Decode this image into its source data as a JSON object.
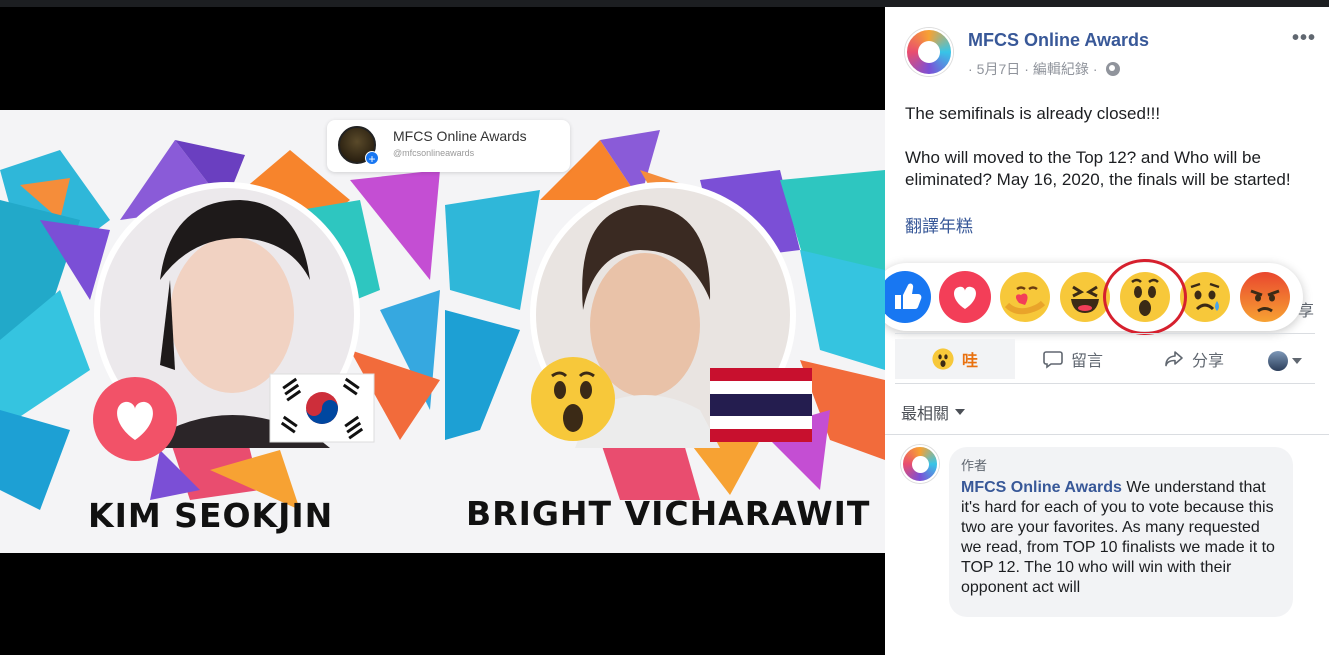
{
  "photo": {
    "tag_name": "MFCS Online Awards",
    "tag_handle": "@mfcsonlineawards",
    "left_name": "KIM SEOKJIN",
    "right_name": "BRIGHT VICHARAWIT"
  },
  "post": {
    "page_name": "MFCS Online Awards",
    "date": "5月7日",
    "edit_history": "編輯紀錄",
    "text_line1": "The semifinals is already closed!!!",
    "text_line2": "Who will moved to the Top 12? and Who will be eliminated? May 16, 2020, the finals will be started!",
    "translate_label": "翻譯年糕",
    "share_fragment": "享"
  },
  "reactions": [
    "like-icon",
    "love-icon",
    "care-icon",
    "haha-icon",
    "wow-icon",
    "sad-icon",
    "angry-icon"
  ],
  "actions": {
    "reaction_label": "哇",
    "comment_label": "留言",
    "share_label": "分享"
  },
  "comments": {
    "sort_label": "最相關",
    "author_tag": "作者",
    "author_name": "MFCS Online Awards",
    "text": "We understand that it's hard for each of you to vote because this two are your favorites. As many requested we read, from TOP 10 finalists we made it to TOP 12. The 10 who will win with their opponent act will"
  },
  "colors": {
    "link": "#385898",
    "wow": "#e9710f",
    "highlight_ring": "#d6202e"
  }
}
